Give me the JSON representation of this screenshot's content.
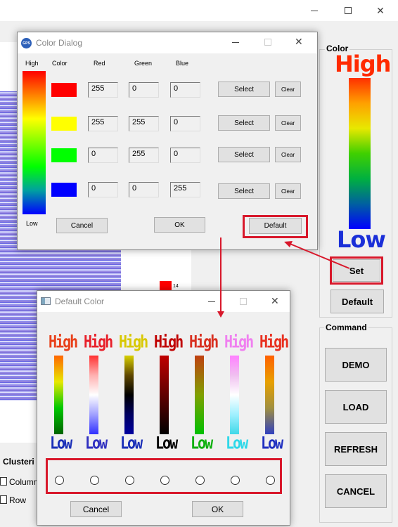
{
  "main_window": {
    "color_group_title": "Color",
    "high_label": "High",
    "low_label": "Low",
    "set_button": "Set",
    "default_button": "Default",
    "command_group_title": "Command",
    "commands": [
      "DEMO",
      "LOAD",
      "REFRESH",
      "CANCEL"
    ],
    "cluster_title": "Clusteri",
    "checkbox_column": "Column",
    "checkbox_row": "Row",
    "legend_value": "14"
  },
  "color_dialog": {
    "title": "Color Dialog",
    "app_icon_text": "GPS",
    "headers": {
      "high": "High",
      "color": "Color",
      "red": "Red",
      "green": "Green",
      "blue": "Blue"
    },
    "low_label": "Low",
    "rows": [
      {
        "swatch": "#ff0000",
        "red": "255",
        "green": "0",
        "blue": "0"
      },
      {
        "swatch": "#ffff00",
        "red": "255",
        "green": "255",
        "blue": "0"
      },
      {
        "swatch": "#00ff00",
        "red": "0",
        "green": "255",
        "blue": "0"
      },
      {
        "swatch": "#0000ff",
        "red": "0",
        "green": "0",
        "blue": "255"
      }
    ],
    "select_label": "Select",
    "clear_label": "Clear",
    "cancel_button": "Cancel",
    "ok_button": "OK",
    "default_button": "Default"
  },
  "default_color_dialog": {
    "title": "Default Color",
    "high_label": "High",
    "low_label": "Low",
    "schemes": [
      {
        "high_color": "#e8401a",
        "low_color": "#1a2fb8",
        "gradient": [
          "#ff6600",
          "#e8e800",
          "#00c800",
          "#006400"
        ]
      },
      {
        "high_color": "#e8202a",
        "low_color": "#3030c0",
        "gradient": [
          "#ff3030",
          "#ffb0b0",
          "#ffffff",
          "#a0a0ff",
          "#3030ff"
        ]
      },
      {
        "high_color": "#d8c800",
        "low_color": "#1a2fb8",
        "gradient": [
          "#d8d000",
          "#604800",
          "#000000",
          "#000060",
          "#0000a0"
        ]
      },
      {
        "high_color": "#c00000",
        "low_color": "#000000",
        "gradient": [
          "#c00000",
          "#600000",
          "#000000"
        ]
      },
      {
        "high_color": "#d83020",
        "low_color": "#10b010",
        "gradient": [
          "#c04010",
          "#80a000",
          "#00c000"
        ]
      },
      {
        "high_color": "#f080f0",
        "low_color": "#30d8e8",
        "gradient": [
          "#ff80ff",
          "#f0c0f0",
          "#ffffff",
          "#a0f0ff",
          "#40d8e8"
        ]
      },
      {
        "high_color": "#e83020",
        "low_color": "#2030c0",
        "gradient": [
          "#ff6000",
          "#e8a000",
          "#a09040",
          "#3040c0"
        ]
      }
    ],
    "cancel_button": "Cancel",
    "ok_button": "OK"
  },
  "accent": {
    "annotation_red": "#d8182b"
  }
}
